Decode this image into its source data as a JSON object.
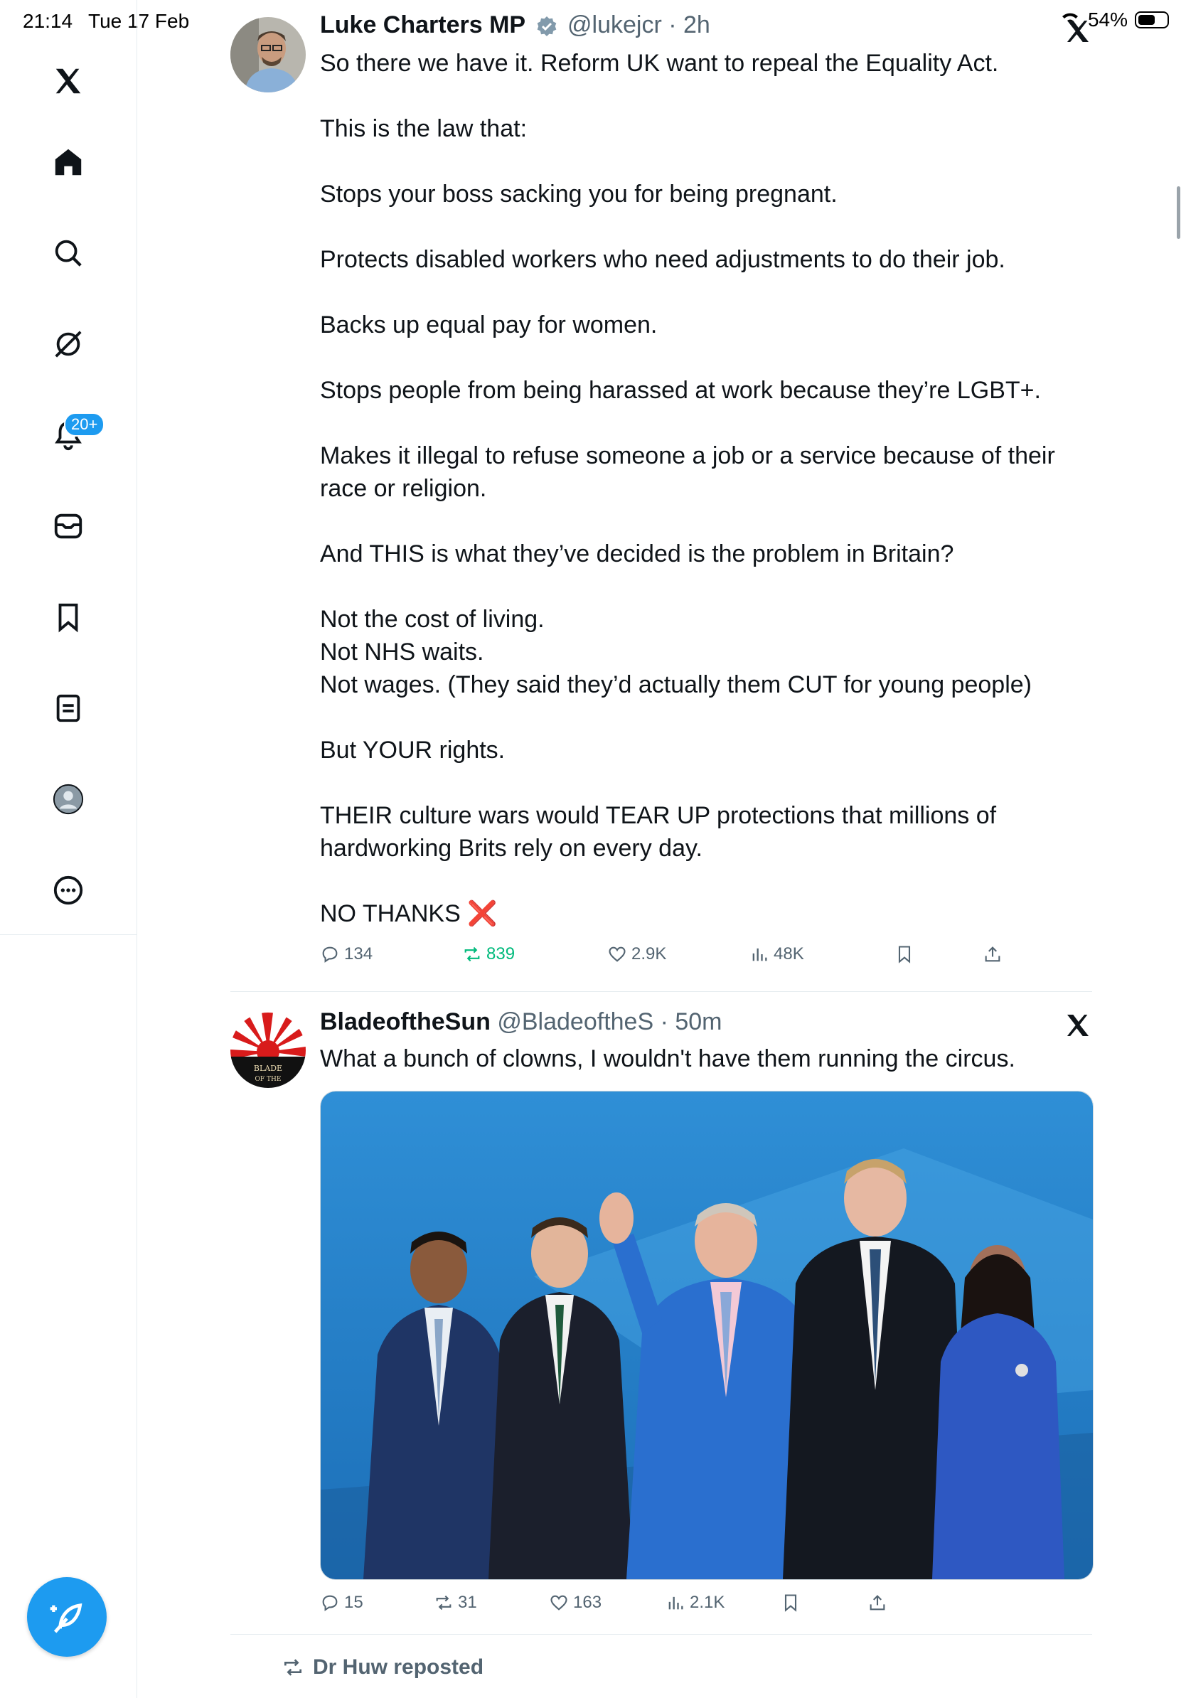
{
  "status": {
    "time": "21:14",
    "date": "Tue 17 Feb",
    "battery": "54%"
  },
  "sidebar": {
    "notifications_badge": "20+",
    "items": [
      "x-logo",
      "home",
      "search",
      "grok",
      "notifications",
      "messages",
      "bookmarks",
      "lists",
      "profile",
      "more"
    ]
  },
  "tweets": [
    {
      "name": "Luke Charters MP",
      "handle": "@lukejcr",
      "time": "· 2h",
      "text": "So there we have it. Reform UK want to repeal the Equality Act.\n\nThis is the law that:\n\nStops your boss sacking you for being pregnant.\n\nProtects disabled workers who need adjustments to do their job.\n\nBacks up equal pay for women.\n\nStops people from being harassed at work because they’re LGBT+.\n\nMakes it illegal to refuse someone a job or a service because of their race or religion.\n\nAnd THIS is what they’ve decided is the problem in Britain?\n\nNot the cost of living.\nNot NHS waits.\nNot wages. (They said they’d actually them CUT for young people)\n\nBut YOUR rights.\n\nTHEIR culture wars would TEAR UP protections that millions of hardworking Brits rely on every day.\n\nNO THANKS",
      "closing_emoji": "❌",
      "replies": "134",
      "reposts": "839",
      "likes": "2.9K",
      "views": "48K"
    },
    {
      "name": "BladeoftheSun",
      "handle": "@BladeoftheS",
      "time": "· 50m",
      "text": "What a bunch of clowns, I wouldn't have them running the circus.",
      "avatar_text": "BLADE OF THE",
      "replies": "15",
      "reposts": "31",
      "likes": "163",
      "views": "2.1K"
    }
  ],
  "next_repost_label": "Dr Huw reposted",
  "colors": {
    "accent": "#1d9bf0",
    "repost_active": "#00ba7c",
    "muted": "#536471"
  }
}
